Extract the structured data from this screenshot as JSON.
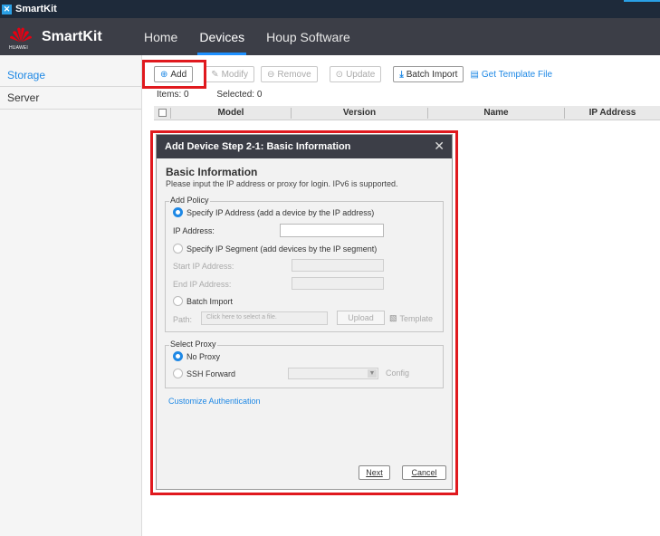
{
  "window": {
    "title": "SmartKit"
  },
  "header": {
    "brand": "SmartKit",
    "logo_text": "HUAWEI",
    "nav": [
      {
        "label": "Home"
      },
      {
        "label": "Devices",
        "active": true
      },
      {
        "label": "Houp Software"
      }
    ]
  },
  "sidebar": {
    "items": [
      {
        "label": "Storage",
        "active": true
      },
      {
        "label": "Server"
      }
    ]
  },
  "toolbar": {
    "add_label": "Add",
    "modify_label": "Modify",
    "remove_label": "Remove",
    "update_label": "Update",
    "batch_import_label": "Batch Import",
    "get_template_label": "Get Template File"
  },
  "counts": {
    "items": "Items: 0",
    "selected": "Selected: 0"
  },
  "table": {
    "columns": [
      "Model",
      "Version",
      "Name",
      "IP Address"
    ]
  },
  "dialog": {
    "title": "Add Device Step 2-1: Basic Information",
    "heading": "Basic Information",
    "subheading": "Please input the IP address or proxy for login. IPv6 is supported.",
    "add_policy": {
      "legend": "Add Policy",
      "opt_ip": "Specify IP Address (add a device by the IP address)",
      "ip_label": "IP Address:",
      "opt_segment": "Specify IP Segment (add devices by the IP segment)",
      "start_label": "Start IP Address:",
      "end_label": "End IP Address:",
      "opt_batch": "Batch Import",
      "path_label": "Path:",
      "path_placeholder": "Click here to select a file.",
      "upload_label": "Upload",
      "template_label": "Template"
    },
    "proxy": {
      "legend": "Select Proxy",
      "opt_none": "No Proxy",
      "opt_ssh": "SSH Forward",
      "config_label": "Config"
    },
    "customize_label": "Customize Authentication",
    "next_label": "Next",
    "cancel_label": "Cancel"
  },
  "colors": {
    "accent": "#1e88e5",
    "header": "#3c3e47",
    "annotation": "#e0191e"
  }
}
